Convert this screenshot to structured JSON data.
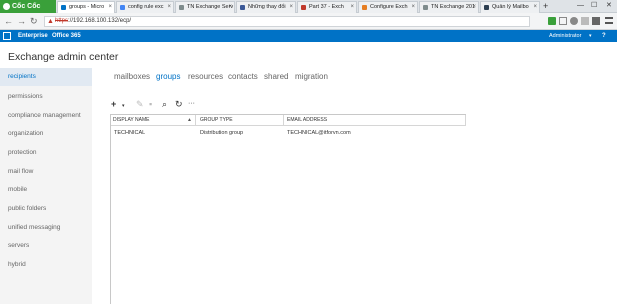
{
  "browser": {
    "brand": "Cốc Cốc",
    "tabs": [
      {
        "label": "groups - Micro",
        "fav": "#0072c6"
      },
      {
        "label": "config rule exc",
        "fav": "#4285f4"
      },
      {
        "label": "TN Exchange Serv",
        "fav": "#7f8c8d"
      },
      {
        "label": "Những thay đổi",
        "fav": "#3b5998"
      },
      {
        "label": "Part 37 - Exch",
        "fav": "#c0392b"
      },
      {
        "label": "Configure Exch",
        "fav": "#e67e22"
      },
      {
        "label": "TN Exchange 201",
        "fav": "#7f8c8d"
      },
      {
        "label": "Quản lý Mailbo",
        "fav": "#2c3e50"
      }
    ],
    "close_glyph": "×",
    "new_tab_glyph": "+",
    "url_protocol": "https",
    "url_rest": "://192.168.100.132/ecp/",
    "warning_glyph": "▲",
    "window_controls": [
      "—",
      "☐",
      "✕"
    ],
    "nav": {
      "back": "←",
      "forward": "→",
      "reload": "↻"
    }
  },
  "o365": {
    "nav": [
      "Enterprise",
      "Office 365"
    ],
    "admin": "Administrator",
    "admin_dropdown": "▾",
    "help": "?"
  },
  "page": {
    "title": "Exchange admin center"
  },
  "sidebar": {
    "items": [
      "recipients",
      "permissions",
      "compliance management",
      "organization",
      "protection",
      "mail flow",
      "mobile",
      "public folders",
      "unified messaging",
      "servers",
      "hybrid"
    ]
  },
  "subnav": {
    "items": [
      "mailboxes",
      "groups",
      "resources",
      "contacts",
      "shared",
      "migration"
    ],
    "active": "groups"
  },
  "toolbar": {
    "add": "+",
    "add_dropdown": "▾",
    "edit": "✎",
    "delete": "▪",
    "search": "⌕",
    "refresh": "↻",
    "more": "···"
  },
  "table": {
    "columns": [
      "DISPLAY NAME",
      "GROUP TYPE",
      "EMAIL ADDRESS"
    ],
    "sort_glyph": "▲",
    "rows": [
      {
        "display_name": "TECHNICAL",
        "group_type": "Distribution group",
        "email": "TECHNICAL@itforvn.com"
      }
    ]
  },
  "colors": {
    "o365_bar": "#0072c6",
    "accent": "#0072c6",
    "brand_green": "#3aa03a"
  }
}
